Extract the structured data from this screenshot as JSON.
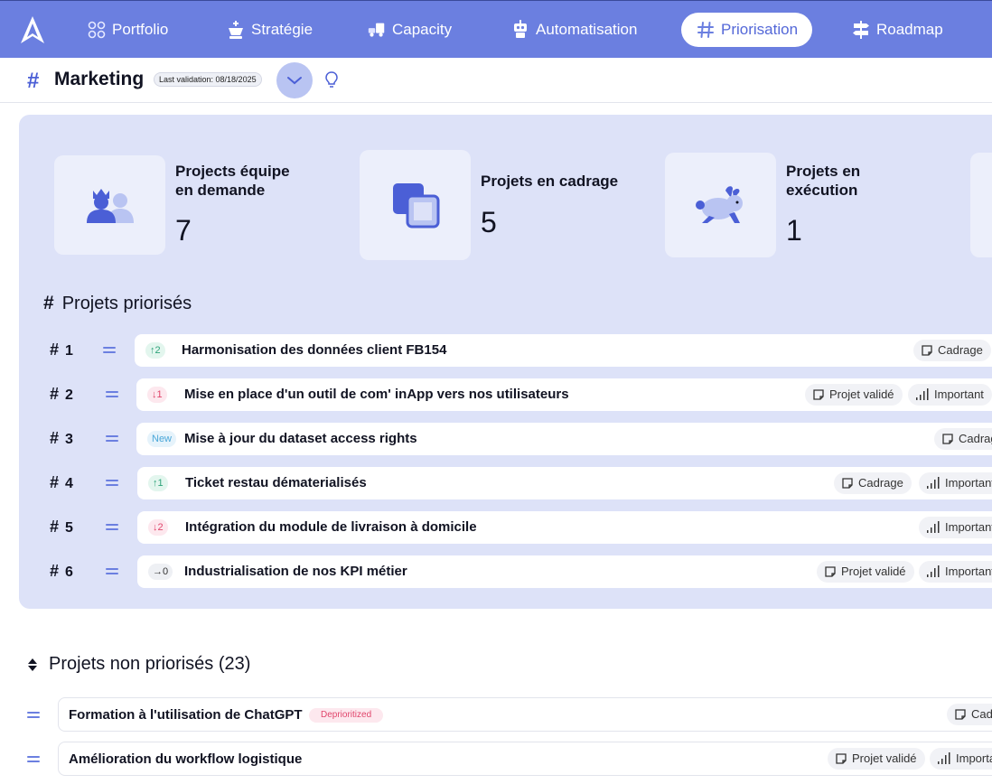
{
  "nav": {
    "items": [
      {
        "key": "portfolio",
        "label": "Portfolio",
        "icon": "atom-icon"
      },
      {
        "key": "strategie",
        "label": "Stratégie",
        "icon": "chess-king-icon"
      },
      {
        "key": "capacity",
        "label": "Capacity",
        "icon": "truck-icon"
      },
      {
        "key": "automatisation",
        "label": "Automatisation",
        "icon": "robot-icon"
      },
      {
        "key": "priorisation",
        "label": "Priorisation",
        "icon": "hashtag-icon",
        "active": true
      },
      {
        "key": "roadmap",
        "label": "Roadmap",
        "icon": "signpost-icon"
      }
    ]
  },
  "team": {
    "hash": "#",
    "name": "Marketing",
    "last_validation": "Last validation: 08/18/2025"
  },
  "stats": [
    {
      "label": "Projects équipe en demande",
      "value": "7",
      "icon": "users-icon"
    },
    {
      "label": "Projets en cadrage",
      "value": "5",
      "icon": "squares-icon"
    },
    {
      "label": "Projets en exécution",
      "value": "1",
      "icon": "rabbit-icon"
    }
  ],
  "prioritized": {
    "hash": "#",
    "title": "Projets priorisés",
    "rank_symbol": "#",
    "rows": [
      {
        "rank": "1",
        "trend": "↑2",
        "trend_type": "up",
        "title": "Harmonisation des données client FB154",
        "tags": [
          "Cadrage"
        ]
      },
      {
        "rank": "2",
        "trend": "↓1",
        "trend_type": "down",
        "title": "Mise en place d'un outil de com' inApp vers nos utilisateurs",
        "tags": [
          "Projet validé",
          "Important"
        ]
      },
      {
        "rank": "3",
        "trend": "New",
        "trend_type": "new",
        "title": "Mise à jour du dataset access rights",
        "tags": [
          "Cadrage"
        ]
      },
      {
        "rank": "4",
        "trend": "↑1",
        "trend_type": "up",
        "title": "Ticket restau dématerialisés",
        "tags": [
          "Cadrage",
          "Important"
        ]
      },
      {
        "rank": "5",
        "trend": "↓2",
        "trend_type": "down",
        "title": "Intégration du module de livraison à domicile",
        "tags": [
          "Important"
        ]
      },
      {
        "rank": "6",
        "trend": "→0",
        "trend_type": "flat",
        "title": "Industrialisation de nos KPI métier",
        "tags": [
          "Projet validé",
          "Important"
        ]
      }
    ]
  },
  "non_prioritized": {
    "title": "Projets non priorisés (23)",
    "rows": [
      {
        "title": "Formation à l'utilisation de ChatGPT",
        "badge": "Deprioritized",
        "tags": [
          "Cadrage"
        ]
      },
      {
        "title": "Amélioration du workflow logistique",
        "tags": [
          "Projet validé",
          "Important"
        ]
      }
    ]
  },
  "colors": {
    "accent": "#6b7fe0",
    "panel": "#dde2f8",
    "up": "#2fa37a",
    "down": "#e0456b"
  }
}
